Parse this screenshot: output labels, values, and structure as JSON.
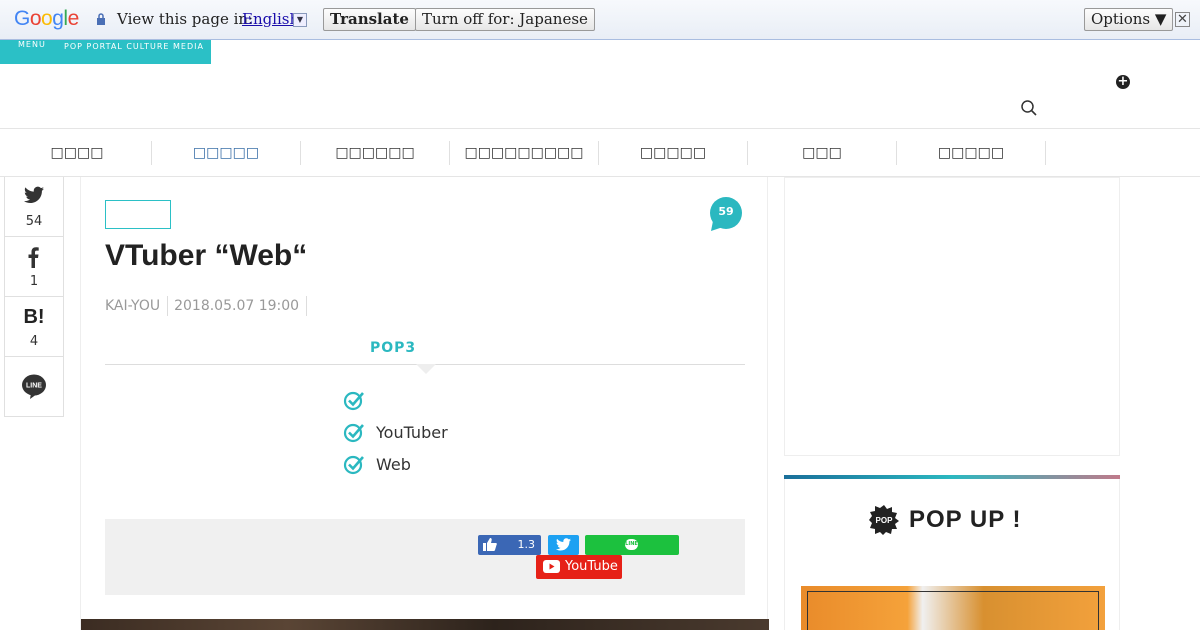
{
  "translate_bar": {
    "logo": [
      "G",
      "o",
      "o",
      "g",
      "l",
      "e"
    ],
    "prompt": "View this page in:",
    "language": "English",
    "translate_label": "Translate",
    "turn_off_label": "Turn off for: Japanese",
    "options_label": "Options ▼",
    "close_label": "✕"
  },
  "header": {
    "menu_label": "MENU",
    "tagline": "POP PORTAL CULTURE MEDIA",
    "plus_glyph": "+"
  },
  "nav": {
    "items": [
      {
        "label": "□□□□",
        "active": false
      },
      {
        "label": "□□□□□",
        "active": true
      },
      {
        "label": "□□□□□□",
        "active": false
      },
      {
        "label": "□□□□□□□□□",
        "active": false
      },
      {
        "label": "□□□□□",
        "active": false
      },
      {
        "label": "□□□",
        "active": false
      },
      {
        "label": "□□□□□",
        "active": false
      }
    ]
  },
  "share": {
    "twitter_count": "54",
    "facebook_count": "1",
    "hatena_label": "B!",
    "hatena_count": "4",
    "line_label": "LINE"
  },
  "article": {
    "comment_count": "59",
    "title": "VTuber “Web“",
    "author": "KAI-YOU",
    "date": "2018.05.07 19:00",
    "pop3_heading": "POP3",
    "pop3_items": [
      "",
      "YouTuber",
      "Web"
    ],
    "like_count": "1.3",
    "line_share_label": "LINE",
    "youtube_label": "YouTube"
  },
  "sidebar": {
    "popup_logo_text": "POP",
    "popup_title": "POP UP !"
  },
  "colors": {
    "accent": "#2bc0c6",
    "twitter": "#1da1f2",
    "facebook_like": "#3b67b5",
    "line": "#1cc13e",
    "youtube": "#e62117"
  }
}
